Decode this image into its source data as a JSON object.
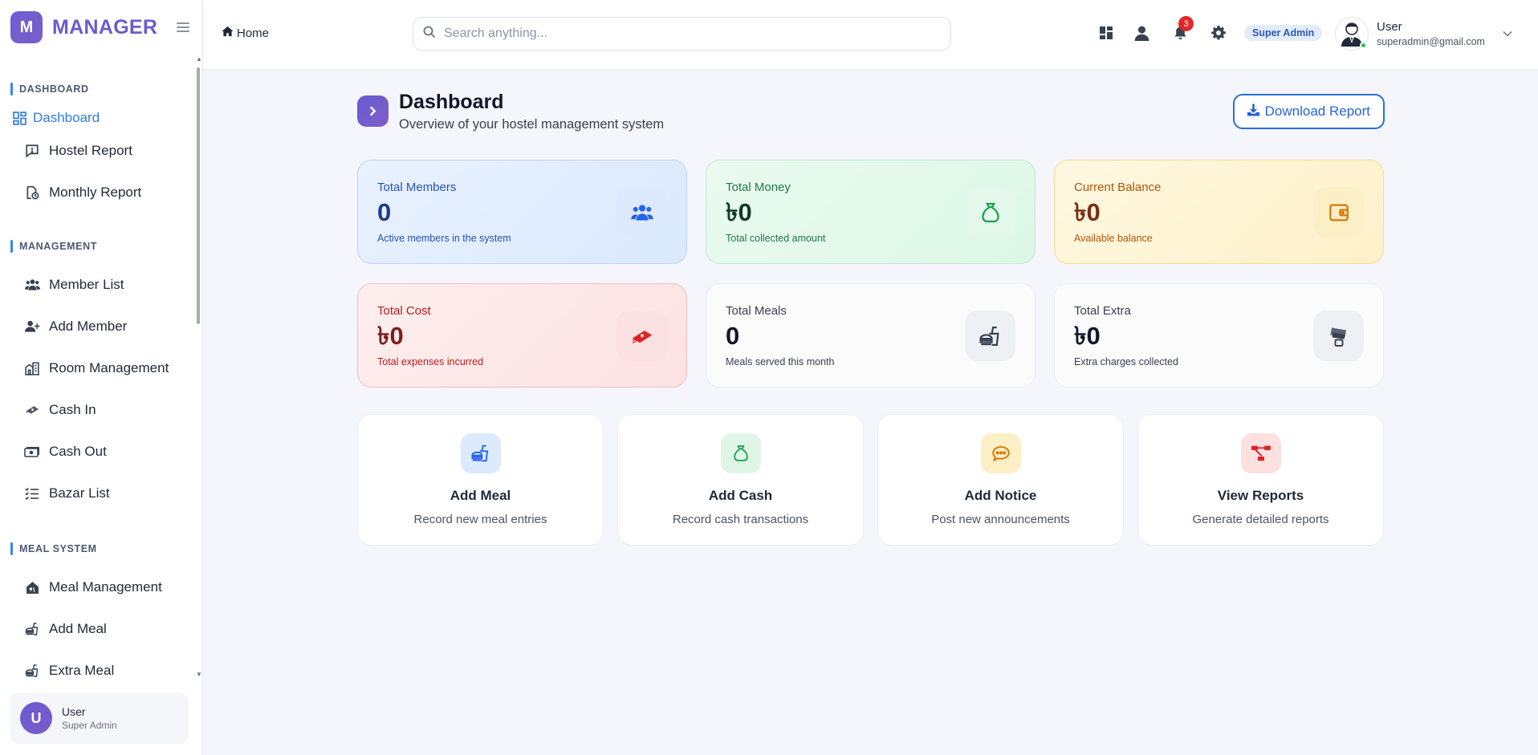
{
  "brand": {
    "logo_letter": "M",
    "name": "MANAGER"
  },
  "sidebar": {
    "sections": [
      {
        "title": "DASHBOARD",
        "items": [
          {
            "label": "Dashboard",
            "icon": "dashboard-grid-icon",
            "active": true
          },
          {
            "label": "Hostel Report",
            "icon": "report-icon"
          },
          {
            "label": "Monthly Report",
            "icon": "calendar-report-icon"
          }
        ]
      },
      {
        "title": "MANAGEMENT",
        "items": [
          {
            "label": "Member List",
            "icon": "users-icon"
          },
          {
            "label": "Add Member",
            "icon": "user-plus-icon"
          },
          {
            "label": "Room Management",
            "icon": "building-icon"
          },
          {
            "label": "Cash In",
            "icon": "money-icon"
          },
          {
            "label": "Cash Out",
            "icon": "money-bill-icon"
          },
          {
            "label": "Bazar List",
            "icon": "list-check-icon"
          }
        ]
      },
      {
        "title": "MEAL SYSTEM",
        "items": [
          {
            "label": "Meal Management",
            "icon": "home-meal-icon"
          },
          {
            "label": "Add Meal",
            "icon": "meal-icon"
          },
          {
            "label": "Extra Meal",
            "icon": "meal-icon"
          }
        ]
      }
    ],
    "user": {
      "initial": "U",
      "name": "User",
      "role": "Super Admin"
    }
  },
  "header": {
    "breadcrumb": "Home",
    "search_placeholder": "Search anything...",
    "notification_count": "3",
    "role_badge": "Super Admin",
    "user_name": "User",
    "user_email": "superadmin@gmail.com"
  },
  "page": {
    "title": "Dashboard",
    "subtitle": "Overview of your hostel management system",
    "download_label": "Download Report"
  },
  "stats": [
    {
      "label": "Total Members",
      "value": "0",
      "sub": "Active members in the system",
      "color": "#2563eb",
      "icon": "users-icon"
    },
    {
      "label": "Total Money",
      "value": "৳0",
      "sub": "Total collected amount",
      "color": "#16a34a",
      "icon": "money-bag-icon"
    },
    {
      "label": "Current Balance",
      "value": "৳0",
      "sub": "Available balance",
      "color": "#d97706",
      "icon": "wallet-icon"
    },
    {
      "label": "Total Cost",
      "value": "৳0",
      "sub": "Total expenses incurred",
      "color": "#dc2626",
      "icon": "money-stack-icon"
    },
    {
      "label": "Total Meals",
      "value": "0",
      "sub": "Meals served this month",
      "color": "#374151",
      "icon": "meal-icon"
    },
    {
      "label": "Total Extra",
      "value": "৳0",
      "sub": "Extra charges collected",
      "color": "#374151",
      "icon": "money-fly-icon"
    }
  ],
  "actions": [
    {
      "title": "Add Meal",
      "sub": "Record new meal entries",
      "icon": "meal-icon"
    },
    {
      "title": "Add Cash",
      "sub": "Record cash transactions",
      "icon": "money-bag-icon"
    },
    {
      "title": "Add Notice",
      "sub": "Post new announcements",
      "icon": "chat-icon"
    },
    {
      "title": "View Reports",
      "sub": "Generate detailed reports",
      "icon": "diagram-icon"
    }
  ]
}
